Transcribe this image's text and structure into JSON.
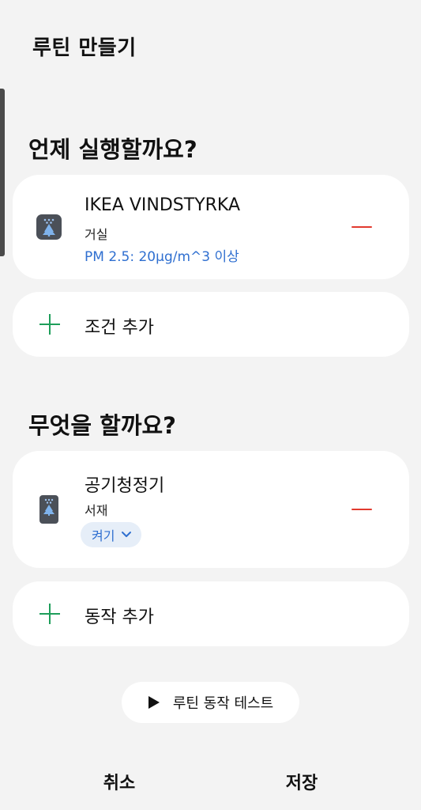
{
  "header": {
    "title": "루틴 만들기"
  },
  "when": {
    "title": "언제 실행할까요?",
    "condition": {
      "device_name": "IKEA VINDSTYRKA",
      "room": "거실",
      "condition_text": "PM 2.5: 20μg/m^3 이상",
      "icon": "air-sensor-icon"
    },
    "add_label": "조건 추가"
  },
  "what": {
    "title": "무엇을 할까요?",
    "action": {
      "device_name": "공기청정기",
      "room": "서재",
      "state_label": "켜기",
      "icon": "air-purifier-icon"
    },
    "add_label": "동작 추가"
  },
  "test_button": {
    "label": "루틴 동작 테스트"
  },
  "footer": {
    "cancel_label": "취소",
    "save_label": "저장"
  },
  "colors": {
    "accent_blue": "#2f6fd0",
    "add_green": "#1e9e5a",
    "remove_red": "#e23a2e"
  }
}
